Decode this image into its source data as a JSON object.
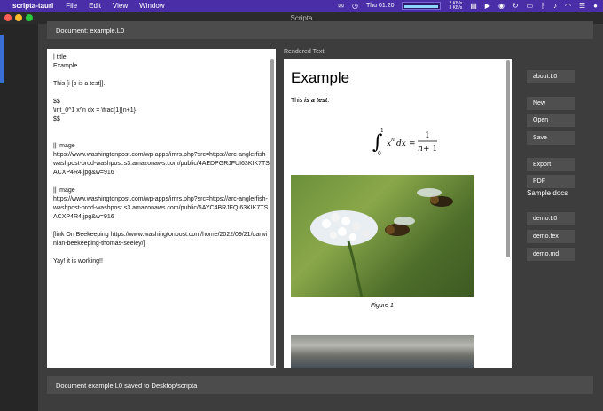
{
  "menubar": {
    "app_name": "scripta-tauri",
    "items": [
      "File",
      "Edit",
      "View",
      "Window"
    ],
    "clock": "Thu 01:20",
    "net_up": "2 KB/s",
    "net_down": "3 KB/s"
  },
  "window": {
    "title": "Scripta"
  },
  "document_header": "Document: example.L0",
  "editor": {
    "lines": [
      "| title",
      "Example",
      "",
      "This [i [b is a test]].",
      "",
      "$$",
      "\\int_0^1 x^n dx = \\frac{1}{n+1}",
      "$$",
      "",
      "",
      "|| image",
      "https://www.washingtonpost.com/wp-apps/imrs.php?src=https://arc-anglerfish-washpost-prod-washpost.s3.amazonaws.com/public/4AEDPGRJFUI63KIK7TSACXP4R4.jpg&w=916",
      "",
      "|| image",
      "https://www.washingtonpost.com/wp-apps/imrs.php?src=https://arc-anglerfish-washpost-prod-washpost.s3.amazonaws.com/public/5AYC4BRJFQI63KIK7TSACXP4R4.jpg&w=916",
      "",
      "[link On Beekeeping https://www.washingtonpost.com/home/2022/09/21/darwinian-beekeeping-thomas-seeley/]",
      "",
      "Yay! it is working!!"
    ]
  },
  "rendered": {
    "label": "Rendered Text",
    "title": "Example",
    "para_prefix": "This ",
    "para_emph": "is a test",
    "para_suffix": ".",
    "figure_caption": "Figure 1"
  },
  "sidebar": {
    "about": "about.L0",
    "new": "New",
    "open": "Open",
    "save": "Save",
    "export": "Export",
    "pdf": "PDF",
    "sample_label": "Sample docs",
    "samples": [
      "demo.L0",
      "demo.tex",
      "demo.md"
    ]
  },
  "status": "Document example.L0 saved to Desktop/scripta"
}
